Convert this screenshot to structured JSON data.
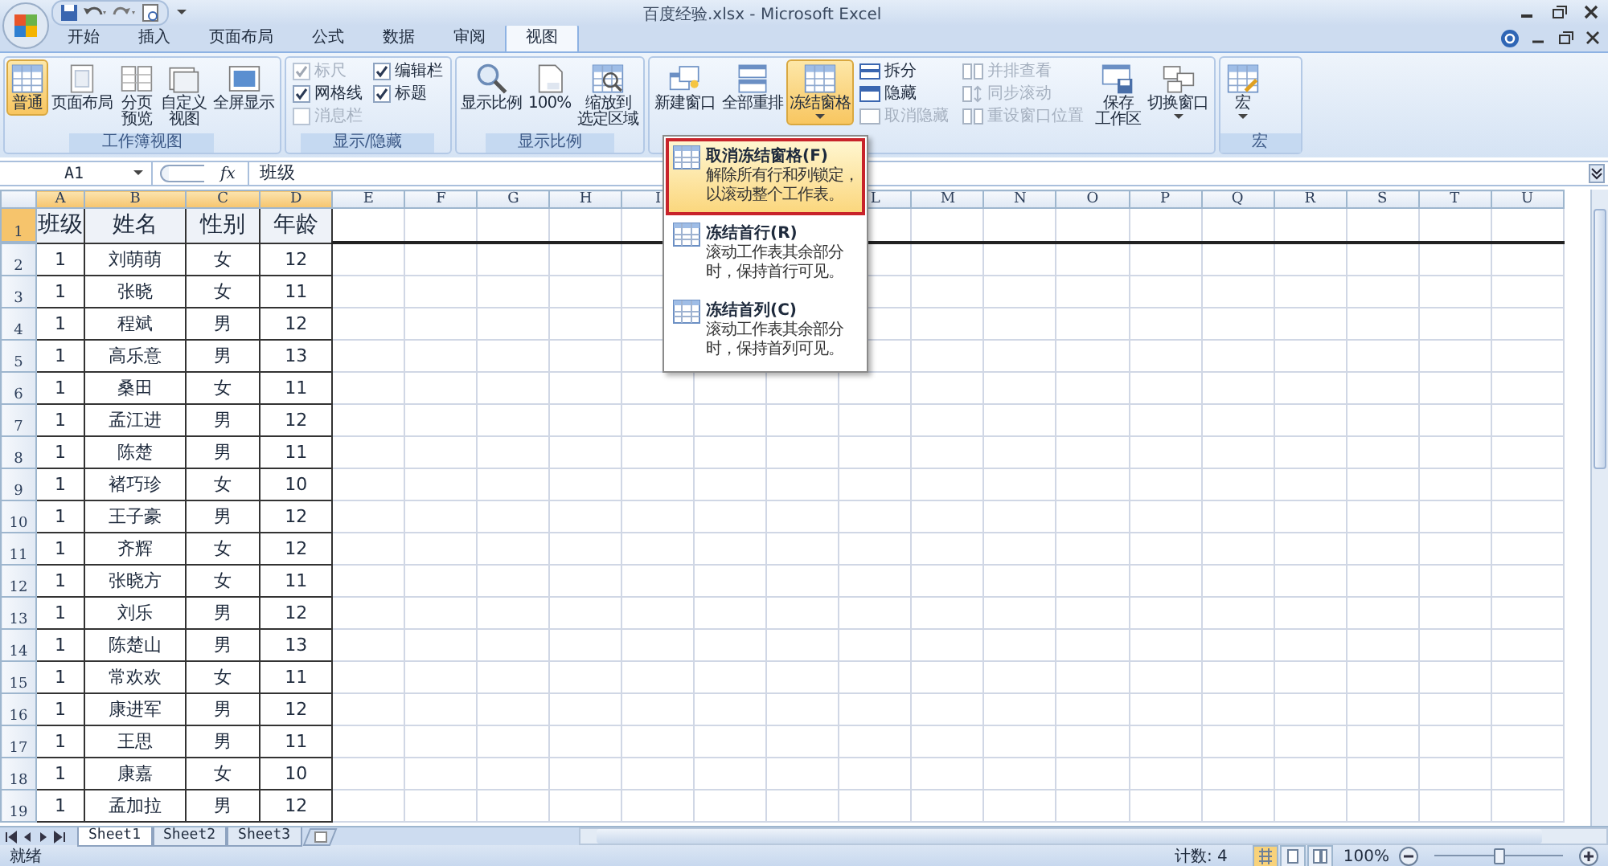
{
  "title_bar": {
    "title": "百度经验.xlsx - Microsoft Excel"
  },
  "ribbon_tabs": [
    {
      "label": "开始",
      "selected": false
    },
    {
      "label": "插入",
      "selected": false
    },
    {
      "label": "页面布局",
      "selected": false
    },
    {
      "label": "公式",
      "selected": false
    },
    {
      "label": "数据",
      "selected": false
    },
    {
      "label": "审阅",
      "selected": false
    },
    {
      "label": "视图",
      "selected": true
    }
  ],
  "ribbon_groups": [
    {
      "label": "工作簿视图",
      "items": [
        {
          "kind": "large",
          "label": [
            "普通"
          ],
          "selected": true,
          "dropdown": false
        },
        {
          "kind": "large",
          "label": [
            "页面布局"
          ],
          "selected": false,
          "dropdown": false
        },
        {
          "kind": "large",
          "label": [
            "分页",
            "预览"
          ],
          "selected": false,
          "dropdown": false
        },
        {
          "kind": "large",
          "label": [
            "自定义",
            "视图"
          ],
          "selected": false,
          "dropdown": false
        },
        {
          "kind": "large",
          "label": [
            "全屏显示"
          ],
          "selected": false,
          "dropdown": false
        }
      ]
    },
    {
      "label": "显示/隐藏",
      "items": [
        {
          "kind": "check",
          "label": "标尺",
          "checked": true,
          "disabled": true
        },
        {
          "kind": "check",
          "label": "网格线",
          "checked": true,
          "disabled": false
        },
        {
          "kind": "check",
          "label": "消息栏",
          "checked": false,
          "disabled": true
        },
        {
          "kind": "check",
          "label": "编辑栏",
          "checked": true,
          "disabled": false
        },
        {
          "kind": "check",
          "label": "标题",
          "checked": true,
          "disabled": false
        }
      ]
    },
    {
      "label": "显示比例",
      "items": [
        {
          "kind": "large",
          "label": [
            "显示比例"
          ],
          "selected": false,
          "dropdown": false
        },
        {
          "kind": "large",
          "label": [
            "100%"
          ],
          "selected": false,
          "dropdown": false
        },
        {
          "kind": "large",
          "label": [
            "缩放到",
            "选定区域"
          ],
          "selected": false,
          "dropdown": false
        }
      ]
    },
    {
      "items": [
        {
          "kind": "large",
          "label": [
            "新建窗口"
          ],
          "selected": false,
          "dropdown": false
        },
        {
          "kind": "large",
          "label": [
            "全部重排"
          ],
          "selected": false,
          "dropdown": false
        },
        {
          "kind": "large",
          "label": [
            "冻结窗格"
          ],
          "selected": true,
          "dropdown": true,
          "menu": {
            "items": [
              {
                "title": "取消冻结窗格(F)",
                "description": [
                  "解除所有行和列锁定，",
                  "以滚动整个工作表。"
                ],
                "selected": true
              },
              {
                "title": "冻结首行(R)",
                "description": [
                  "滚动工作表其余部分",
                  "时，保持首行可见。"
                ],
                "selected": false
              },
              {
                "title": "冻结首列(C)",
                "description": [
                  "滚动工作表其余部分",
                  "时，保持首列可见。"
                ],
                "selected": false
              }
            ]
          }
        },
        {
          "kind": "small",
          "label": "拆分",
          "disabled": false
        },
        {
          "kind": "small",
          "label": "隐藏",
          "disabled": false
        },
        {
          "kind": "small",
          "label": "取消隐藏",
          "disabled": true
        },
        {
          "kind": "small",
          "label": "并排查看",
          "disabled": true
        },
        {
          "kind": "small",
          "label": "同步滚动",
          "disabled": true
        },
        {
          "kind": "small",
          "label": "重设窗口位置",
          "disabled": true
        },
        {
          "kind": "large",
          "label": [
            "保存",
            "工作区"
          ],
          "selected": false,
          "dropdown": false
        },
        {
          "kind": "large",
          "label": [
            "切换窗口"
          ],
          "selected": false,
          "dropdown": true
        }
      ]
    },
    {
      "label": "宏",
      "items": [
        {
          "kind": "large",
          "label": [
            "宏"
          ],
          "selected": false,
          "dropdown": true
        }
      ]
    }
  ],
  "formula_bar": {
    "name_box": "A1",
    "fx": "fx",
    "formula": "班级"
  },
  "sheet": {
    "columns": [
      "A",
      "B",
      "C",
      "D",
      "E",
      "F",
      "G",
      "H",
      "I",
      "L",
      "M",
      "N",
      "O",
      "P",
      "Q",
      "R",
      "S",
      "T",
      "U"
    ],
    "rows": [
      {
        "number": "1",
        "cells": [
          "班级",
          "姓名",
          "性别",
          "年龄"
        ]
      },
      {
        "number": "2",
        "cells": [
          "1",
          "刘萌萌",
          "女",
          "12"
        ]
      },
      {
        "number": "3",
        "cells": [
          "1",
          "张晓",
          "女",
          "11"
        ]
      },
      {
        "number": "4",
        "cells": [
          "1",
          "程斌",
          "男",
          "12"
        ]
      },
      {
        "number": "5",
        "cells": [
          "1",
          "高乐意",
          "男",
          "13"
        ]
      },
      {
        "number": "6",
        "cells": [
          "1",
          "桑田",
          "女",
          "11"
        ]
      },
      {
        "number": "7",
        "cells": [
          "1",
          "孟江进",
          "男",
          "12"
        ]
      },
      {
        "number": "8",
        "cells": [
          "1",
          "陈楚",
          "男",
          "11"
        ]
      },
      {
        "number": "9",
        "cells": [
          "1",
          "褚巧珍",
          "女",
          "10"
        ]
      },
      {
        "number": "10",
        "cells": [
          "1",
          "王子豪",
          "男",
          "12"
        ]
      },
      {
        "number": "11",
        "cells": [
          "1",
          "齐辉",
          "女",
          "12"
        ]
      },
      {
        "number": "12",
        "cells": [
          "1",
          "张晓方",
          "女",
          "11"
        ]
      },
      {
        "number": "13",
        "cells": [
          "1",
          "刘乐",
          "男",
          "12"
        ]
      },
      {
        "number": "14",
        "cells": [
          "1",
          "陈楚山",
          "男",
          "13"
        ]
      },
      {
        "number": "15",
        "cells": [
          "1",
          "常欢欢",
          "女",
          "11"
        ]
      },
      {
        "number": "16",
        "cells": [
          "1",
          "康进军",
          "男",
          "12"
        ]
      },
      {
        "number": "17",
        "cells": [
          "1",
          "王思",
          "男",
          "11"
        ]
      },
      {
        "number": "18",
        "cells": [
          "1",
          "康嘉",
          "女",
          "10"
        ]
      },
      {
        "number": "19",
        "cells": [
          "1",
          "孟加拉",
          "男",
          "12"
        ]
      }
    ]
  },
  "sheet_tabs": [
    {
      "label": "Sheet1",
      "selected": true
    },
    {
      "label": "Sheet2",
      "selected": false
    },
    {
      "label": "Sheet3",
      "selected": false
    }
  ],
  "status_bar": {
    "status": "就绪",
    "count": "计数: 4",
    "view_buttons": [
      {
        "selected": true
      },
      {
        "selected": false
      },
      {
        "selected": false
      }
    ],
    "zoom": "100%",
    "zoom_slider": {
      "level": 0.5
    }
  }
}
